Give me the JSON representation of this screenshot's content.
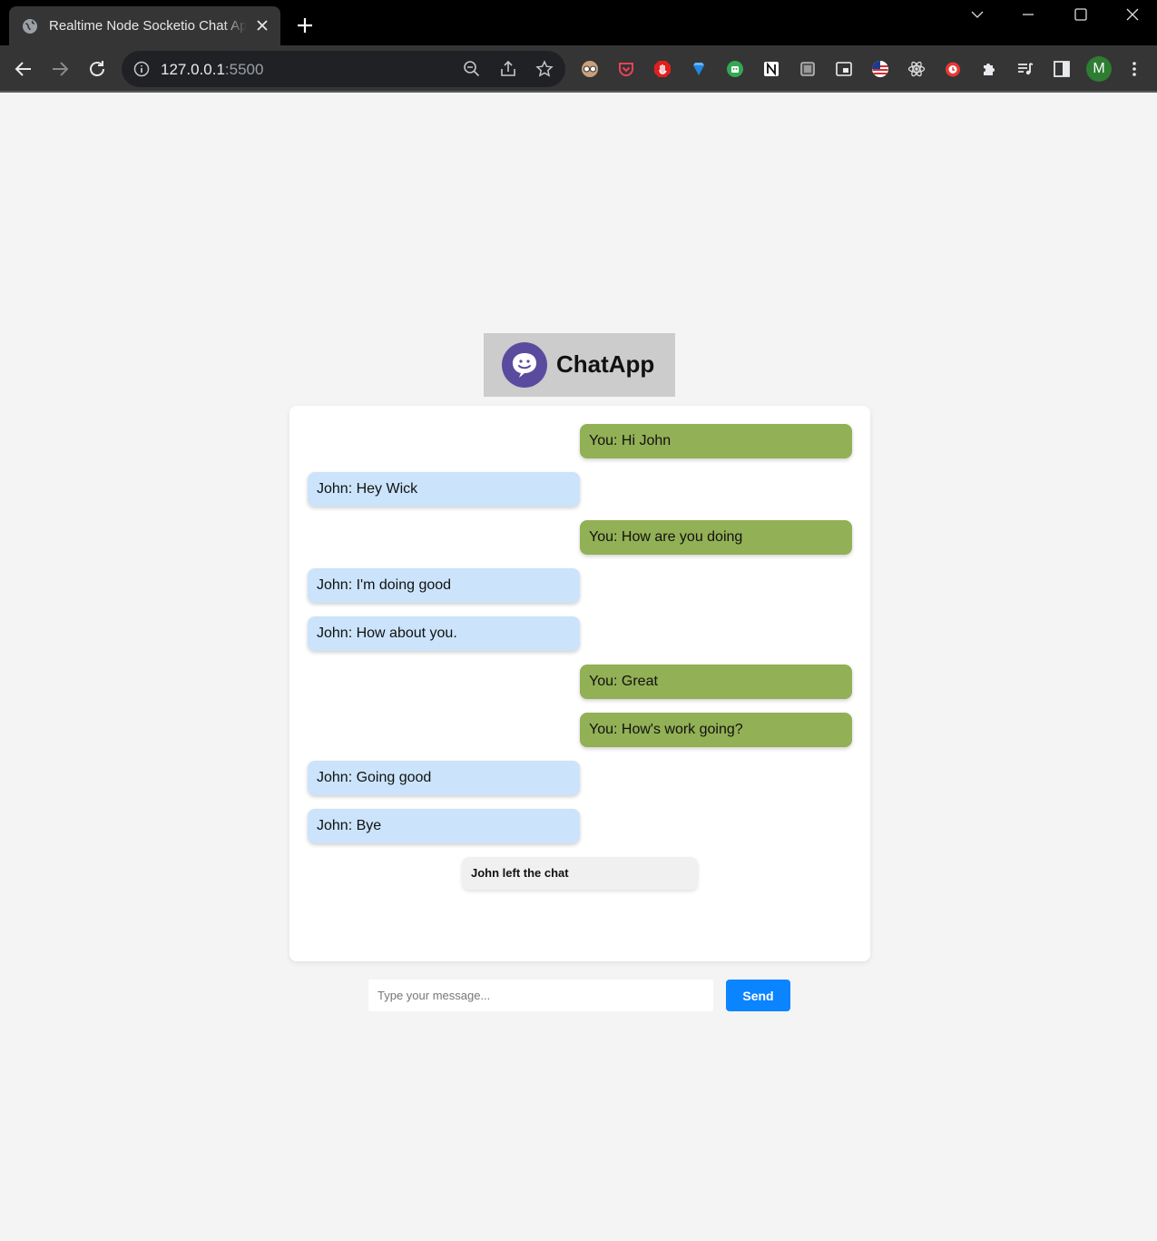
{
  "browser": {
    "tab_title": "Realtime Node Socketio Chat App",
    "url_host": "127.0.0.1",
    "url_port": ":5500",
    "profile_initial": "M",
    "extensions": [
      "glasses-icon",
      "pocket-icon",
      "hand-stop-icon",
      "diamond-icon",
      "robot-icon",
      "notion-icon",
      "chip-icon",
      "pip-icon",
      "flag-icon",
      "react-icon",
      "alarm-icon",
      "puzzle-icon",
      "media-icon",
      "side-panel-icon"
    ]
  },
  "app": {
    "logo_text": "ChatApp",
    "brand_color": "#5b4b9f"
  },
  "messages": [
    {
      "side": "right",
      "text": "You: Hi John"
    },
    {
      "side": "left",
      "text": "John: Hey Wick"
    },
    {
      "side": "right",
      "text": "You: How are you doing"
    },
    {
      "side": "left",
      "text": "John: I'm doing good"
    },
    {
      "side": "left",
      "text": "John: How about you."
    },
    {
      "side": "right",
      "text": "You: Great"
    },
    {
      "side": "right",
      "text": "You: How's work going?"
    },
    {
      "side": "left",
      "text": "John: Going good"
    },
    {
      "side": "left",
      "text": "John: Bye"
    }
  ],
  "notice": "John left the chat",
  "composer": {
    "placeholder": "Type your message...",
    "send_label": "Send"
  },
  "colors": {
    "outgoing_bubble": "#92b055",
    "incoming_bubble": "#cbe4fb",
    "send_button": "#0a84ff"
  }
}
